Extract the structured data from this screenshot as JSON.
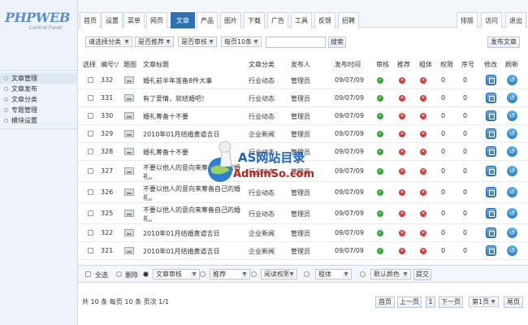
{
  "logo": {
    "text_main": "PHPWEB",
    "text_sub": "Control Panel"
  },
  "sidebar": {
    "items": [
      {
        "label": "文章管理",
        "active": true
      },
      {
        "label": "文章发布",
        "active": false
      },
      {
        "label": "文章分类",
        "active": false
      },
      {
        "label": "专题管理",
        "active": false
      },
      {
        "label": "模块设置",
        "active": false
      }
    ]
  },
  "top_tabs": [
    {
      "label": "首页"
    },
    {
      "label": "设置"
    },
    {
      "label": "菜单"
    },
    {
      "label": "网页"
    },
    {
      "label": "文章",
      "active": true
    },
    {
      "label": "产品"
    },
    {
      "label": "图片"
    },
    {
      "label": "下载"
    },
    {
      "label": "广告"
    },
    {
      "label": "工具"
    },
    {
      "label": "反馈"
    },
    {
      "label": "招聘"
    }
  ],
  "right_tabs": [
    {
      "label": "排版"
    },
    {
      "label": "访问"
    },
    {
      "label": "退出"
    }
  ],
  "filters": {
    "category": "请选择分类",
    "recommend": "是否推荐",
    "audit": "是否审核",
    "perpage": "每页10条",
    "search_value": "",
    "search_button": "搜索",
    "publish_button": "发布文章"
  },
  "table": {
    "headers": [
      "选择",
      "编号",
      "题图",
      "文章标题",
      "文章分类",
      "发布人",
      "发布时间",
      "审核",
      "推荐",
      "粗体",
      "权限",
      "序号",
      "修改",
      "刷新"
    ],
    "rows": [
      {
        "id": "332",
        "title": "婚礼前半年准备8件大事",
        "title2": "",
        "category": "行业动态",
        "author": "管理员",
        "date": "09/07/09",
        "perm": "0",
        "seq": "0"
      },
      {
        "id": "331",
        "title": "有了爱情，就结婚吧！",
        "title2": "",
        "category": "行业动态",
        "author": "管理员",
        "date": "09/07/09",
        "perm": "0",
        "seq": "0"
      },
      {
        "id": "330",
        "title": "婚礼筹备十不要",
        "title2": "",
        "category": "行业动态",
        "author": "管理员",
        "date": "09/07/09",
        "perm": "0",
        "seq": "0"
      },
      {
        "id": "329",
        "title": "2010年01月结婚黄道吉日",
        "title2": "",
        "category": "企业新闻",
        "author": "管理员",
        "date": "09/07/09",
        "perm": "0",
        "seq": "0"
      },
      {
        "id": "328",
        "title": "婚礼筹备十不要",
        "title2": "",
        "category": "行业动态",
        "author": "管理员",
        "date": "09/07/09",
        "perm": "0",
        "seq": "0"
      },
      {
        "id": "327",
        "title": "不要以他人的意向来筹备自己的婚",
        "title2": "礼。",
        "category": "行业动态",
        "author": "管理员",
        "date": "09/07/09",
        "perm": "0",
        "seq": "0"
      },
      {
        "id": "326",
        "title": "不要以他人的意向来筹备自己的婚",
        "title2": "礼。",
        "category": "行业动态",
        "author": "管理员",
        "date": "09/07/09",
        "perm": "0",
        "seq": "0"
      },
      {
        "id": "325",
        "title": "不要以他人的意向来筹备自己的婚",
        "title2": "礼。",
        "category": "行业动态",
        "author": "管理员",
        "date": "09/07/09",
        "perm": "0",
        "seq": "0"
      },
      {
        "id": "322",
        "title": "2010年01月结婚黄道吉日",
        "title2": "",
        "category": "企业新闻",
        "author": "管理员",
        "date": "09/07/09",
        "perm": "0",
        "seq": "0"
      },
      {
        "id": "321",
        "title": "2010年01月结婚黄道吉日",
        "title2": "",
        "category": "企业新闻",
        "author": "管理员",
        "date": "09/07/09",
        "perm": "0",
        "seq": "0"
      }
    ]
  },
  "actions": {
    "select_all": "全选",
    "delete": "删除",
    "audit": "文章审核",
    "recommend": "推荐",
    "permission": "阅读权限",
    "bold": "粗体",
    "color": "默认颜色",
    "submit": "提交"
  },
  "footer": {
    "summary": "共 10 条 每页 10 条 页次 1/1",
    "first": "首页",
    "prev": "上一页",
    "current": "1",
    "next": "下一页",
    "page_select": "第1页",
    "last": "尾页"
  },
  "watermark": {
    "title": "AS网站目录",
    "subtitle": "AdminSo.com"
  },
  "colors": {
    "accent": "#2e6fb5",
    "ok": "#39a83a",
    "no": "#d43a3a"
  }
}
